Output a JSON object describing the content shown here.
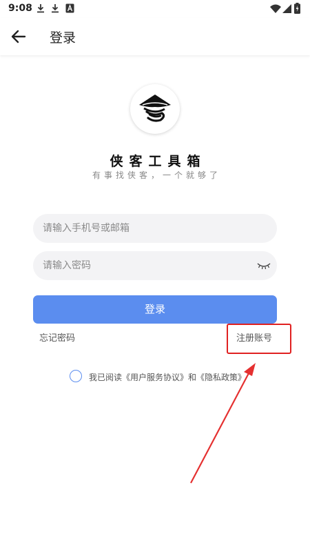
{
  "status_bar": {
    "time": "9:08",
    "icons": [
      "download-icon",
      "download-icon",
      "font-icon",
      "wifi-icon",
      "signal-icon",
      "battery-icon"
    ]
  },
  "app_bar": {
    "back_icon": "arrow-left-icon",
    "title": "登录"
  },
  "app": {
    "logo_icon": "straw-hat-icon",
    "name": "侠客工具箱",
    "slogan": "有事找侠客，一个就够了"
  },
  "form": {
    "account_placeholder": "请输入手机号或邮箱",
    "account_value": "",
    "password_placeholder": "请输入密码",
    "password_value": "",
    "password_toggle_icon": "eye-closed-icon",
    "login_label": "登录",
    "forgot_label": "忘记密码",
    "register_label": "注册账号"
  },
  "agreement": {
    "checked": false,
    "prefix": "我已阅读",
    "user_agreement": "《用户服务协议》",
    "conjunction": "和",
    "privacy_policy": "《隐私政策》"
  },
  "colors": {
    "accent": "#5b8def",
    "annotation": "#e02020",
    "field_bg": "#f3f3f5"
  }
}
